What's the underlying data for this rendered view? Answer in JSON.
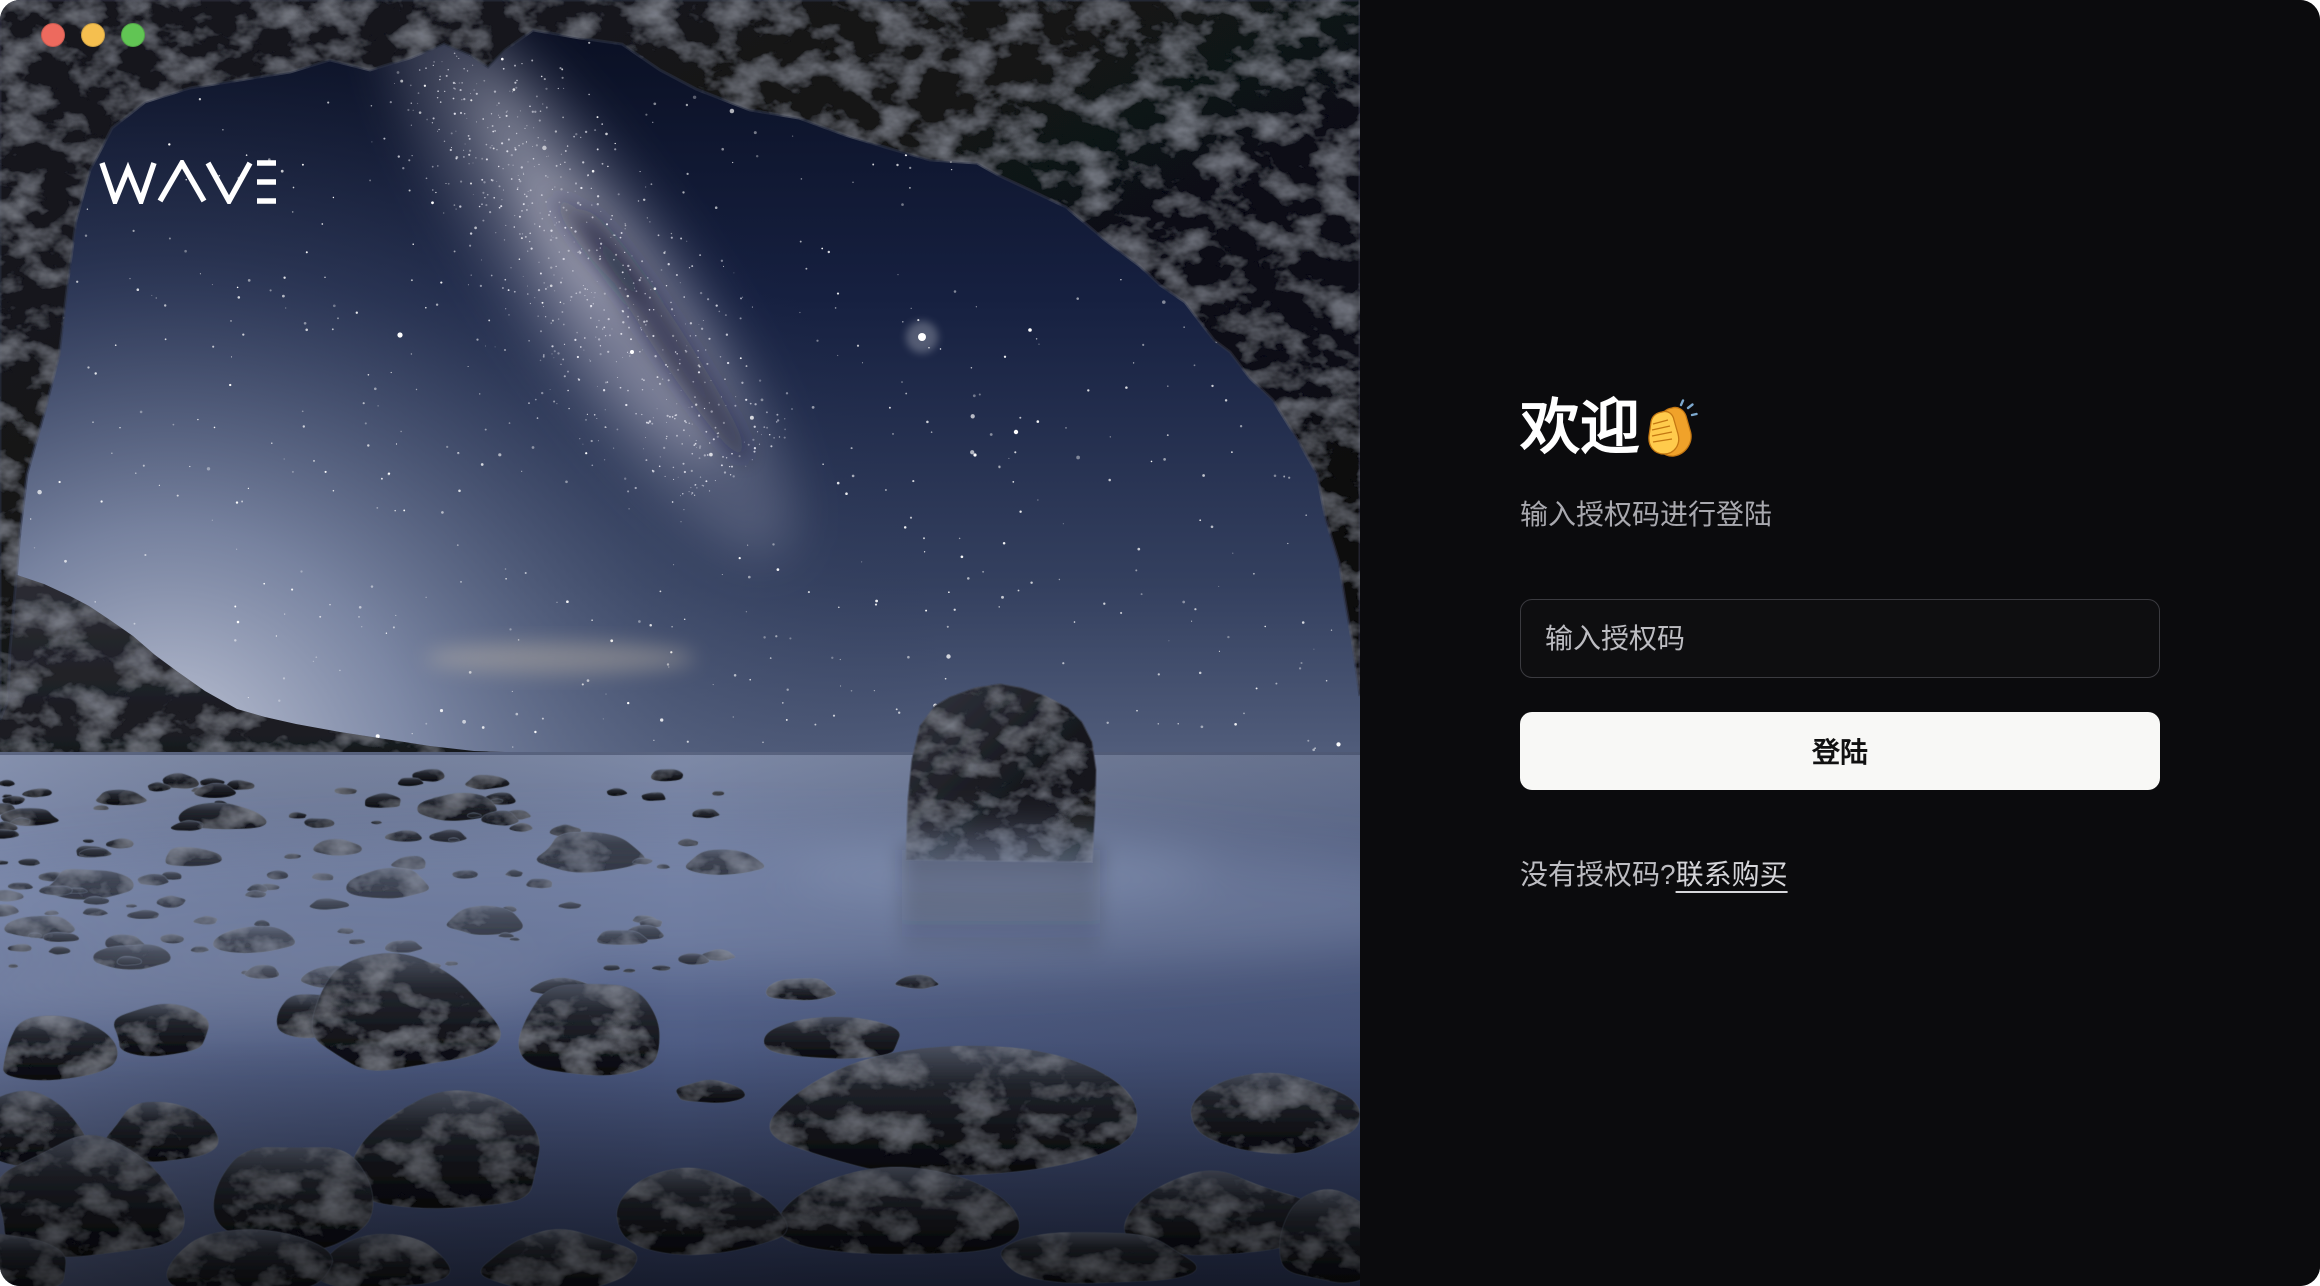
{
  "window": {
    "control_colors": [
      "#ed6a5e",
      "#f5bf4f",
      "#61c554"
    ]
  },
  "brand": {
    "logo_text": "WAVE"
  },
  "login": {
    "title": "欢迎",
    "title_icon": "clapping-hands-icon",
    "subtitle": "输入授权码进行登陆",
    "license_input": {
      "value": "",
      "placeholder": "输入授权码"
    },
    "submit_label": "登陆",
    "no_license_prompt": "没有授权码?",
    "purchase_link": "联系购买"
  },
  "colors": {
    "panel_background": "#0b0b0d",
    "text_primary": "#ffffff",
    "text_secondary": "#a9a9af",
    "button_background": "#f8f8f6"
  }
}
